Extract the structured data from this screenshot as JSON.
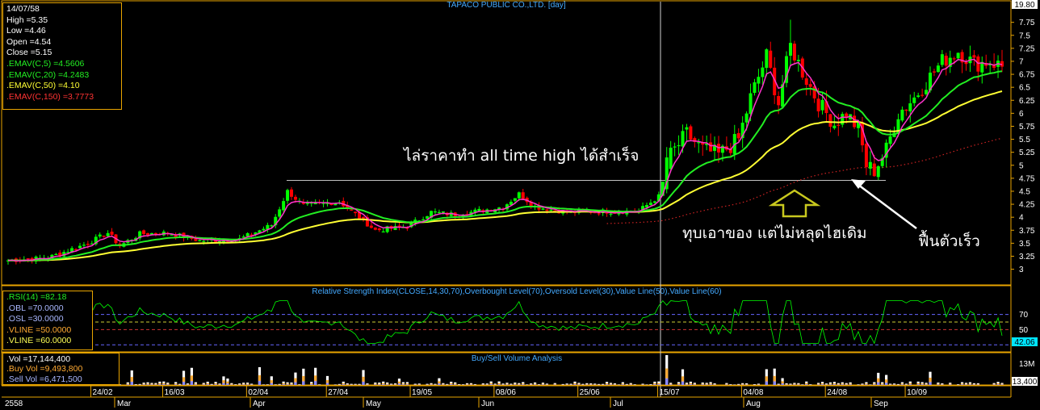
{
  "title": "TAPACO PUBLIC CO.,LTD. [day]",
  "info": {
    "date": "14/07/58",
    "high": "High  =5.35",
    "low": "Low  =4.46",
    "open": "Open  =4.54",
    "close": "Close  =5.15",
    "ema5": ".EMAV(C,5)   =4.5606",
    "ema20": ".EMAV(C,20)   =4.2483",
    "ema50": ".EMAV(C,50)   =4.10",
    "ema150": ".EMAV(C,150)   =3.7773"
  },
  "rsi_info": {
    "rsi": ".RSI(14)   =82.18",
    "obl": ".OBL   =70.0000",
    "osl": ".OSL   =30.0000",
    "vline50": ".VLINE   =50.0000",
    "vline60": ".VLINE   =60.0000"
  },
  "vol_info": {
    "vol": ".Vol   =17,144,400",
    "buy": ".Buy Vol   =9,493,800",
    "sell": ".Sell Vol   =6,471,500"
  },
  "rsi_title": "Relative Strength Index(CLOSE,14,30,70),Overbought Level(70),Oversold Level(30),Value Line(50),Value Line(60)",
  "vol_title": "Buy/Sell Volume Analysis",
  "annotations": {
    "ath": "ไล่ราคาทำ all time high ได้สำเร็จ",
    "dip": "ทุบเอาของ แต่ไม่หลุดไฮเดิม",
    "recover": "ฟื้นตัวเร็ว"
  },
  "badges": {
    "price_top": "19.80",
    "rsi_value": "42.06",
    "vol_value": "13,400"
  },
  "colors": {
    "up": "#00ff00",
    "down": "#ff0000",
    "ema5": "#ff33cc",
    "ema20": "#22ee22",
    "ema50": "#ffff33",
    "ema150": "#cc2222",
    "frame": "#e8a400",
    "title": "#44aaff"
  },
  "chart_data": [
    {
      "type": "candlestick",
      "title": "TAPACO PUBLIC CO.,LTD. [day]",
      "y_ticks": [
        "3",
        "3.25",
        "3.5",
        "3.75",
        "4",
        "4.25",
        "4.5",
        "4.75",
        "5",
        "5.25",
        "5.5",
        "5.75",
        "6",
        "6.25",
        "6.5",
        "6.75",
        "7",
        "7.25",
        "7.5",
        "7.75"
      ],
      "ylim": [
        2.9,
        7.9
      ],
      "x_tick_labels": [
        "24/02",
        "16/03",
        "02/04",
        "27/04",
        "19/05",
        "08/06",
        "25/06",
        "15/07",
        "04/08",
        "24/08",
        "10/09"
      ],
      "month_labels": [
        "2558",
        "Mar",
        "Apr",
        "May",
        "Jun",
        "Jul",
        "Aug",
        "Sep"
      ],
      "reference_high": 4.71,
      "key_points": [
        {
          "date": "14/07/58",
          "open": 4.54,
          "high": 5.35,
          "low": 4.46,
          "close": 5.15
        },
        {
          "label": "peak",
          "high": 7.8
        },
        {
          "label": "dip",
          "low": 4.78
        }
      ],
      "series": [
        {
          "name": ".EMAV(C,5)",
          "last": 4.5606
        },
        {
          "name": ".EMAV(C,20)",
          "last": 4.2483
        },
        {
          "name": ".EMAV(C,50)",
          "last": 4.1
        },
        {
          "name": ".EMAV(C,150)",
          "last": 3.7773
        }
      ]
    },
    {
      "type": "line",
      "title": "Relative Strength Index(CLOSE,14,30,70),Overbought Level(70),Oversold Level(30),Value Line(50),Value Line(60)",
      "y_ticks": [
        "50",
        "70"
      ],
      "ylim": [
        25,
        95
      ],
      "levels": [
        30,
        50,
        60,
        70
      ],
      "series": [
        {
          "name": ".RSI(14)",
          "current": 82.18,
          "last": 42.06
        }
      ]
    },
    {
      "type": "bar",
      "title": "Buy/Sell Volume Analysis",
      "y_ticks": [
        "13M"
      ],
      "series": [
        {
          "name": ".Vol",
          "current": 17144400
        },
        {
          "name": ".Buy Vol",
          "current": 9493800
        },
        {
          "name": ".Sell Vol",
          "current": 6471500
        }
      ]
    }
  ]
}
